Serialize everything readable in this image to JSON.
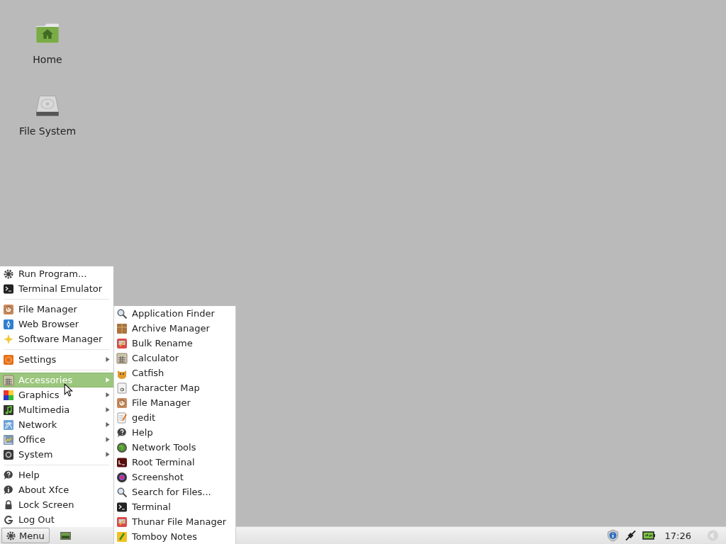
{
  "desktop_icons": [
    {
      "label": "Home"
    },
    {
      "label": "File System"
    }
  ],
  "menu": {
    "sections": [
      [
        {
          "label": "Run Program...",
          "submenu": false,
          "selected": false
        },
        {
          "label": "Terminal Emulator",
          "submenu": false,
          "selected": false
        }
      ],
      [
        {
          "label": "File Manager",
          "submenu": false,
          "selected": false
        },
        {
          "label": "Web Browser",
          "submenu": false,
          "selected": false
        },
        {
          "label": "Software Manager",
          "submenu": false,
          "selected": false
        }
      ],
      [
        {
          "label": "Settings",
          "submenu": true,
          "selected": false
        }
      ],
      [
        {
          "label": "Accessories",
          "submenu": true,
          "selected": true
        },
        {
          "label": "Graphics",
          "submenu": true,
          "selected": false
        },
        {
          "label": "Multimedia",
          "submenu": true,
          "selected": false
        },
        {
          "label": "Network",
          "submenu": true,
          "selected": false
        },
        {
          "label": "Office",
          "submenu": true,
          "selected": false
        },
        {
          "label": "System",
          "submenu": true,
          "selected": false
        }
      ],
      [
        {
          "label": "Help",
          "submenu": false,
          "selected": false
        },
        {
          "label": "About Xfce",
          "submenu": false,
          "selected": false
        },
        {
          "label": "Lock Screen",
          "submenu": false,
          "selected": false
        },
        {
          "label": "Log Out",
          "submenu": false,
          "selected": false
        }
      ]
    ]
  },
  "submenu": {
    "items": [
      {
        "label": "Application Finder"
      },
      {
        "label": "Archive Manager"
      },
      {
        "label": "Bulk Rename"
      },
      {
        "label": "Calculator"
      },
      {
        "label": "Catfish"
      },
      {
        "label": "Character Map"
      },
      {
        "label": "File Manager"
      },
      {
        "label": "gedit"
      },
      {
        "label": "Help"
      },
      {
        "label": "Network Tools"
      },
      {
        "label": "Root Terminal"
      },
      {
        "label": "Screenshot"
      },
      {
        "label": "Search for Files..."
      },
      {
        "label": "Terminal"
      },
      {
        "label": "Thunar File Manager"
      },
      {
        "label": "Tomboy Notes"
      }
    ]
  },
  "panel": {
    "menu_button": "Menu",
    "clock": "17:26"
  }
}
